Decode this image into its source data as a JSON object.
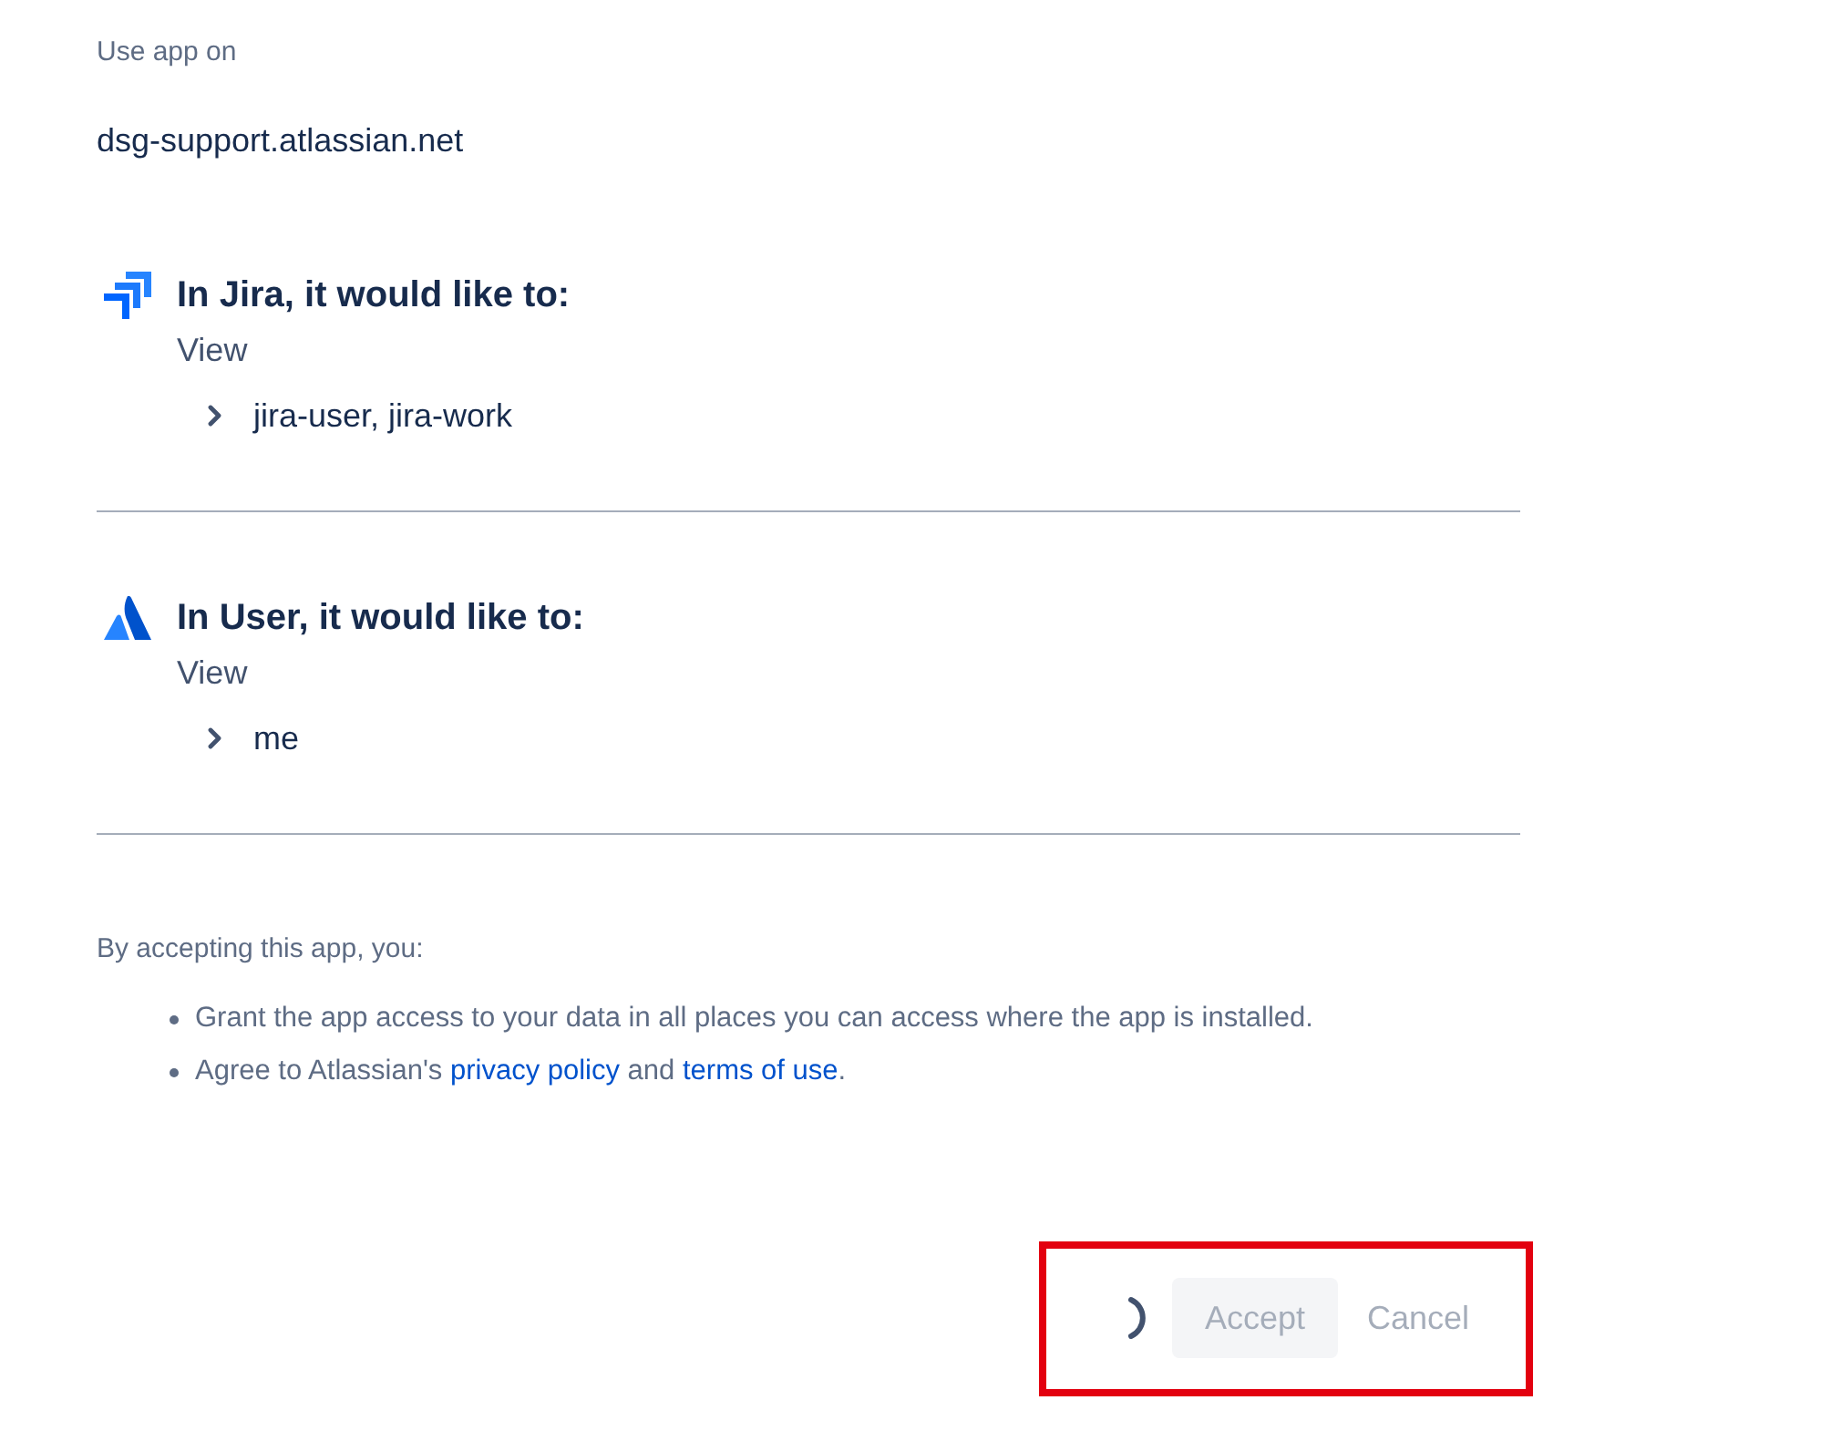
{
  "header": {
    "label": "Use app on",
    "site": "dsg-support.atlassian.net"
  },
  "permissions": [
    {
      "kind": "arrows",
      "title": "In Jira, it would like to:",
      "action": "View",
      "items": [
        {
          "label": "jira-user, jira-work",
          "expanded": false
        }
      ]
    },
    {
      "kind": "mountain",
      "title": "In User, it would like to:",
      "action": "View",
      "items": [
        {
          "label": "me",
          "expanded": false
        }
      ]
    }
  ],
  "consent": {
    "intro": "By accepting this app, you:",
    "points": [
      [
        {
          "kind": "text",
          "text": "Grant the app access to your data in all places you can access where the app is installed."
        }
      ],
      [
        {
          "kind": "text",
          "text": "Agree to Atlassian's "
        },
        {
          "kind": "link",
          "text": "privacy policy"
        },
        {
          "kind": "text",
          "text": " and "
        },
        {
          "kind": "link",
          "text": "terms of use"
        },
        {
          "kind": "text",
          "text": "."
        }
      ]
    ]
  },
  "footer": {
    "highlighted": true,
    "loading": true,
    "buttons": [
      {
        "kind": "primary",
        "label": "Accept",
        "disabled": true
      },
      {
        "kind": "subtle",
        "label": "Cancel",
        "disabled": true
      }
    ]
  }
}
